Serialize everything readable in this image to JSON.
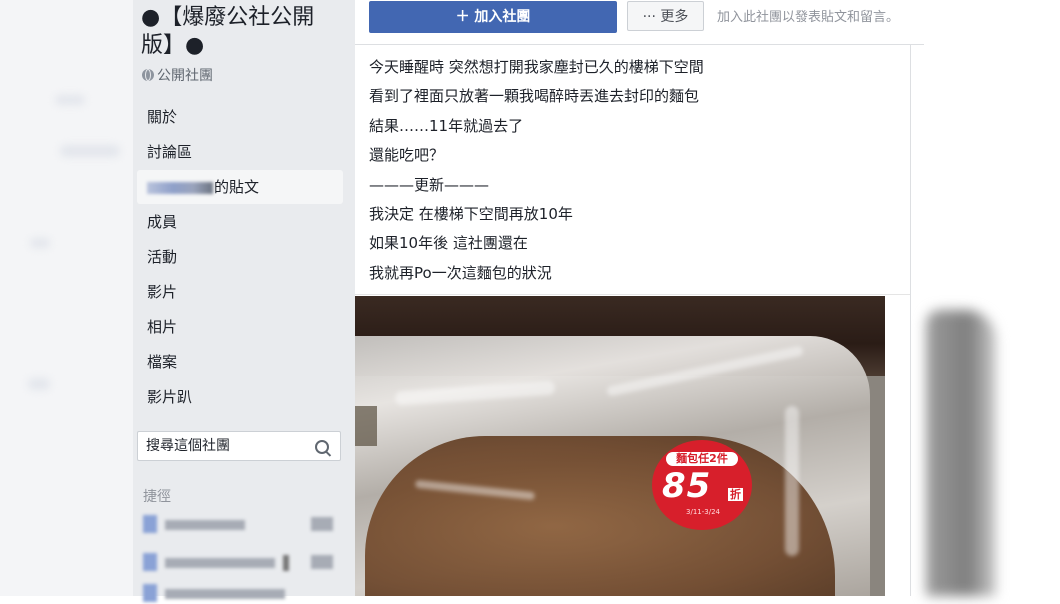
{
  "group": {
    "title": "●【爆廢公社公開版】●",
    "privacy": "公開社團"
  },
  "sidebar": {
    "items": [
      {
        "label": "關於"
      },
      {
        "label": "討論區"
      },
      {
        "label": "的貼文",
        "active": true
      },
      {
        "label": "成員"
      },
      {
        "label": "活動"
      },
      {
        "label": "影片"
      },
      {
        "label": "相片"
      },
      {
        "label": "檔案"
      },
      {
        "label": "影片趴"
      }
    ],
    "search_placeholder": "搜尋這個社團",
    "shortcuts_title": "捷徑"
  },
  "topbar": {
    "join_label": "＋ 加入社團",
    "more_label": "··· 更多",
    "hint": "加入此社團以發表貼文和留言。"
  },
  "post": {
    "lines": [
      "今天睡醒時 突然想打開我家塵封已久的樓梯下空間",
      "看到了裡面只放著一顆我喝醉時丟進去封印的麵包",
      "結果……11年就過去了",
      "還能吃吧？",
      "———更新———",
      "我決定 在樓梯下空間再放10年",
      "如果10年後 這社團還在",
      "我就再Po一次這麵包的狀況"
    ],
    "photo": {
      "sticker_top": "麵包任2件",
      "sticker_value": "85",
      "sticker_unit": "折",
      "sticker_small": "3/11-3/24"
    }
  },
  "colors": {
    "accent": "#4267b2",
    "sidebar_bg": "#e9ebee",
    "sticker_red": "#d71f2b"
  }
}
